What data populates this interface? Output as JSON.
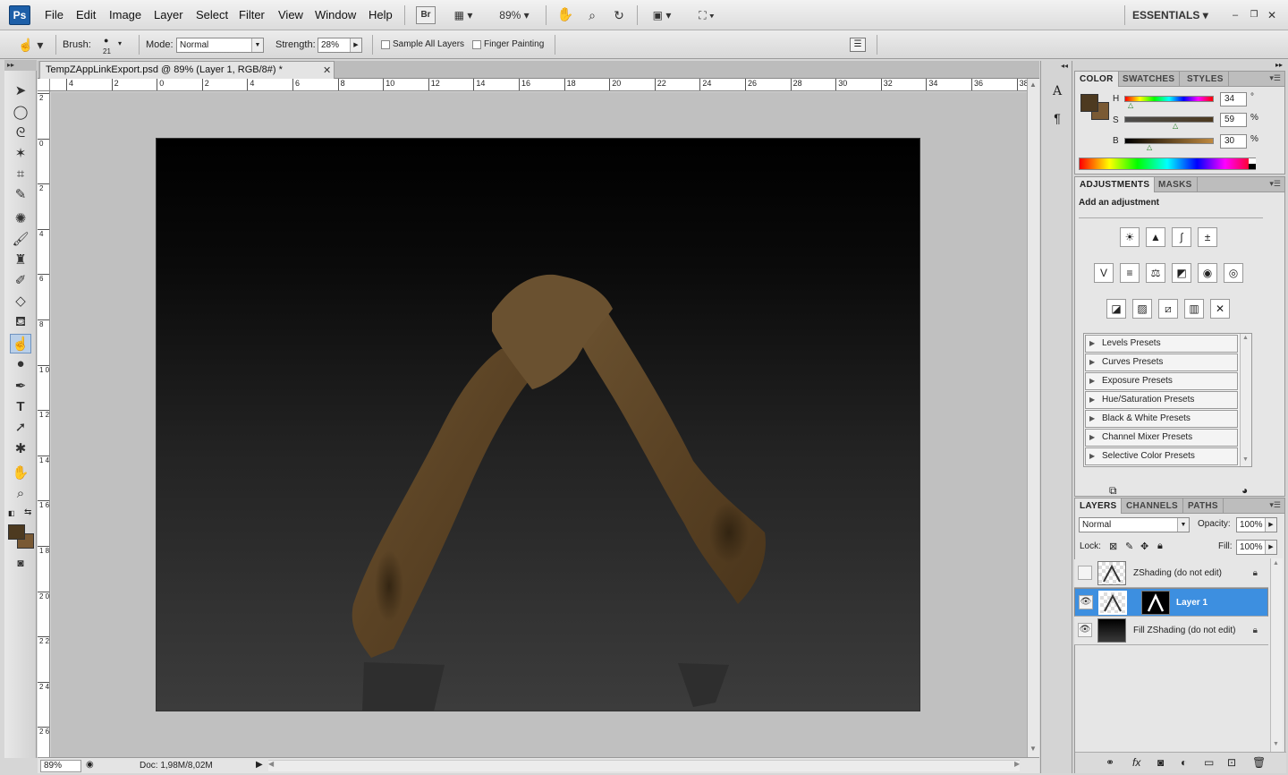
{
  "menubar": {
    "logo": "Ps",
    "items": [
      "File",
      "Edit",
      "Image",
      "Layer",
      "Select",
      "Filter",
      "View",
      "Window",
      "Help"
    ],
    "bridge": "Br",
    "zoom": "89%",
    "workspace": "ESSENTIALS"
  },
  "options": {
    "brush_label": "Brush:",
    "brush_size": "21",
    "mode_label": "Mode:",
    "mode_value": "Normal",
    "strength_label": "Strength:",
    "strength_value": "28%",
    "sample_all_layers": "Sample All Layers",
    "finger_painting": "Finger Painting"
  },
  "document": {
    "tab_title": "TempZAppLinkExport.psd @ 89% (Layer 1, RGB/8#) *",
    "ruler_h": [
      "4",
      "2",
      "0",
      "2",
      "4",
      "6",
      "8",
      "10",
      "12",
      "14",
      "16",
      "18",
      "20",
      "22",
      "24",
      "26",
      "28",
      "30",
      "32",
      "34",
      "36",
      "38"
    ],
    "ruler_v": [
      "2",
      "0",
      "2",
      "4",
      "6",
      "8",
      "1 0",
      "1 2",
      "1 4",
      "1 6",
      "1 8",
      "2 0",
      "2 2",
      "2 4",
      "2 6"
    ]
  },
  "status": {
    "zoom": "89%",
    "doc": "Doc: 1,98M/8,02M"
  },
  "color_panel": {
    "tabs": [
      "COLOR",
      "SWATCHES",
      "STYLES"
    ],
    "h_label": "H",
    "h_value": "34",
    "h_unit": "°",
    "s_label": "S",
    "s_value": "59",
    "s_unit": "%",
    "b_label": "B",
    "b_value": "30",
    "b_unit": "%",
    "h_level": 0.09,
    "s_level": 0.59,
    "b_level": 0.3,
    "foreground": "#4d3a20",
    "background": "#7a5a34"
  },
  "adjustments_panel": {
    "tabs": [
      "ADJUSTMENTS",
      "MASKS"
    ],
    "heading": "Add an adjustment",
    "presets": [
      "Levels Presets",
      "Curves Presets",
      "Exposure Presets",
      "Hue/Saturation Presets",
      "Black & White Presets",
      "Channel Mixer Presets",
      "Selective Color Presets"
    ]
  },
  "layers_panel": {
    "tabs": [
      "LAYERS",
      "CHANNELS",
      "PATHS"
    ],
    "blend_mode": "Normal",
    "opacity_label": "Opacity:",
    "opacity_value": "100%",
    "lock_label": "Lock:",
    "fill_label": "Fill:",
    "fill_value": "100%",
    "layers": [
      {
        "name": "ZShading (do not edit)"
      },
      {
        "name": "Layer 1"
      },
      {
        "name": "Fill ZShading (do not edit)"
      }
    ]
  }
}
